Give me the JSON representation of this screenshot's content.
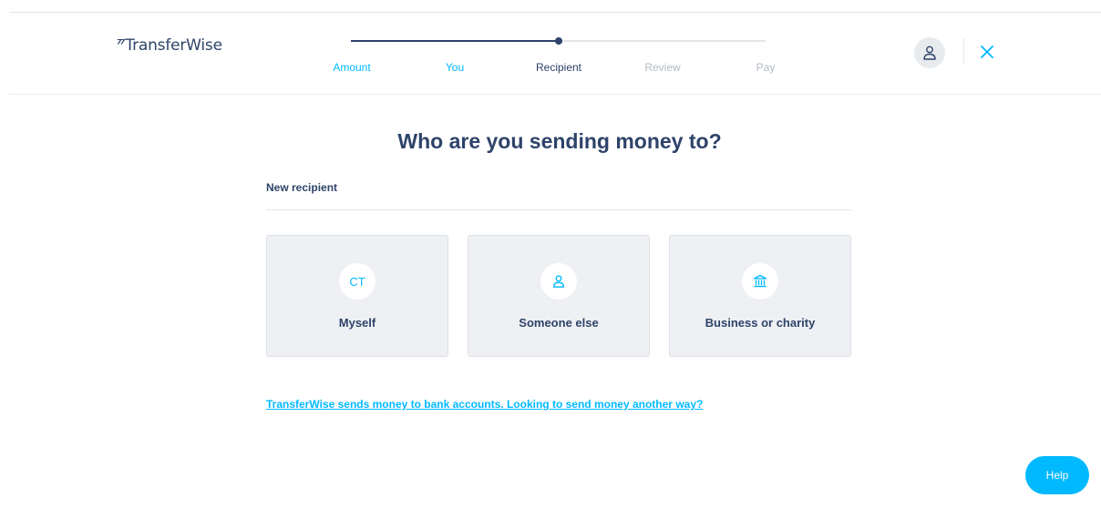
{
  "brand": {
    "mark": "⁷⁷",
    "name": "TransferWise"
  },
  "stepper": {
    "steps": [
      {
        "label": "Amount",
        "state": "done"
      },
      {
        "label": "You",
        "state": "done"
      },
      {
        "label": "Recipient",
        "state": "current"
      },
      {
        "label": "Review",
        "state": "todo"
      },
      {
        "label": "Pay",
        "state": "todo"
      }
    ],
    "progress": 0.5
  },
  "header": {
    "account_icon": "user-icon",
    "close_icon": "close-icon"
  },
  "main": {
    "title": "Who are you sending money to?",
    "section_label": "New recipient",
    "options": [
      {
        "badge": "CT",
        "label": "Myself"
      },
      {
        "icon": "user-icon",
        "label": "Someone else"
      },
      {
        "icon": "bank-icon",
        "label": "Business or charity"
      }
    ],
    "info_link": "TransferWise sends money to bank accounts. Looking to send money another way?"
  },
  "help": {
    "label": "Help"
  },
  "colors": {
    "navy": "#2e4369",
    "accent": "#00b9ff",
    "card_bg": "#eef0f3"
  }
}
